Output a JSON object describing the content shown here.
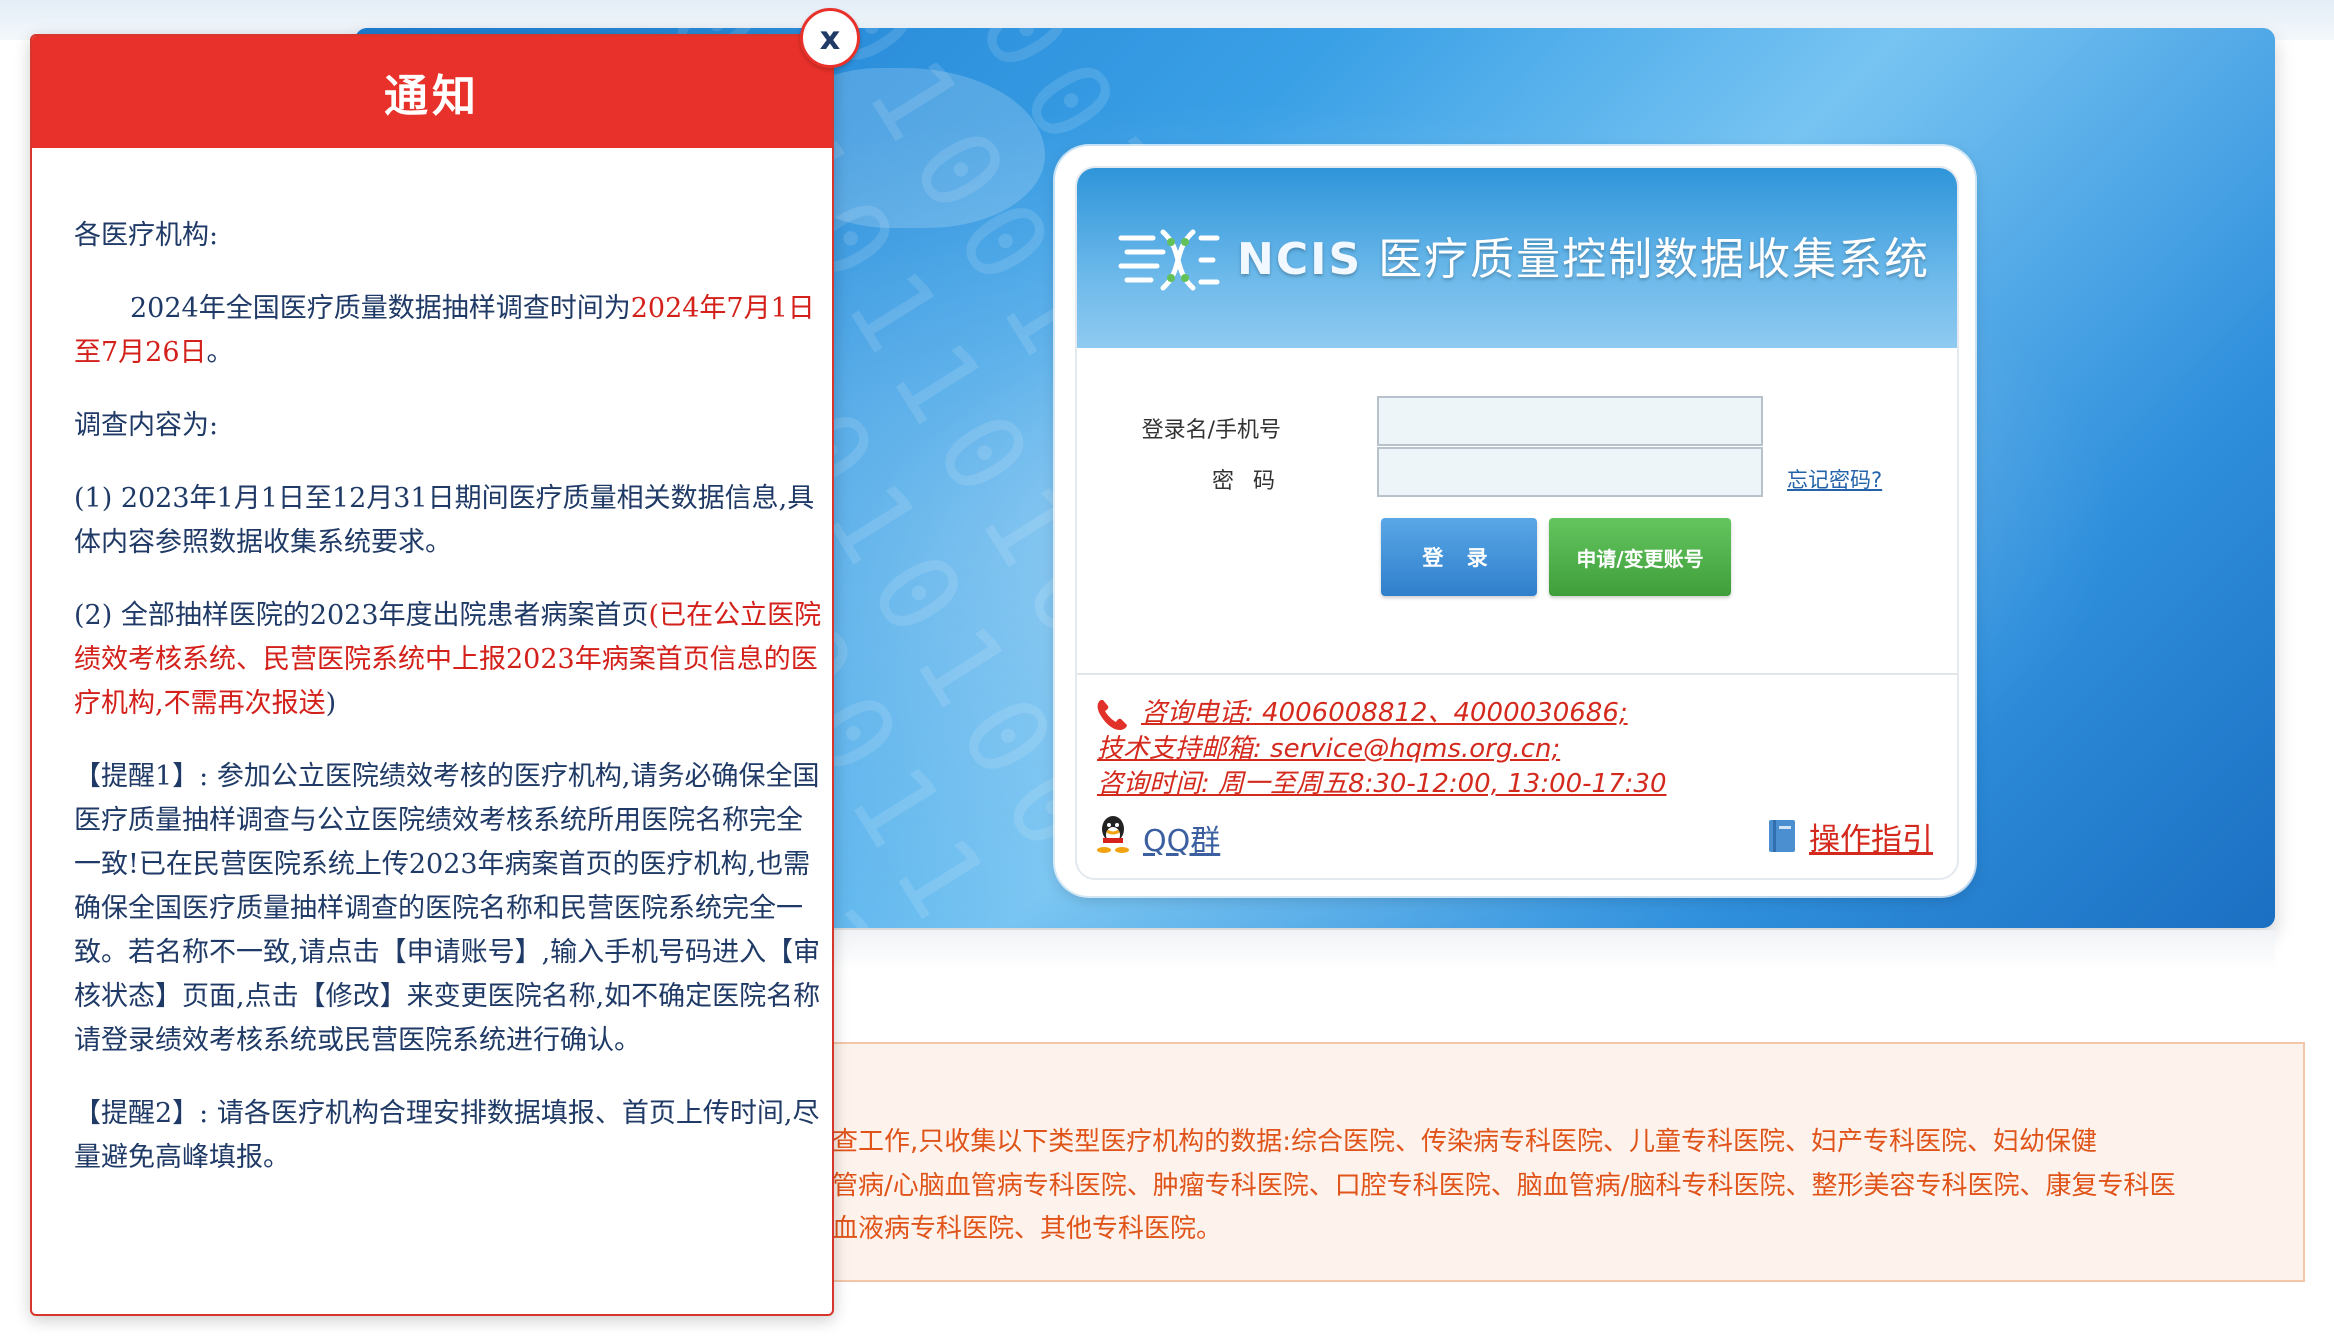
{
  "popup": {
    "title": "通知",
    "close_label": "x",
    "greeting": "各医疗机构:",
    "schedule_prefix": "2024年全国医疗质量数据抽样调查时间为",
    "schedule_dates": "2024年7月1日至7月26日",
    "schedule_suffix": "。",
    "content_heading": "调查内容为:",
    "item1": "(1) 2023年1月1日至12月31日期间医疗质量相关数据信息,具体内容参照数据收集系统要求。",
    "item2_prefix": "(2) 全部抽样医院的2023年度出院患者病案首页",
    "item2_red": "(已在公立医院绩效考核系统、民营医院系统中上报2023年病案首页信息的医疗机构,不需再次报送",
    "item2_suffix": ")",
    "reminder1": "【提醒1】: 参加公立医院绩效考核的医疗机构,请务必确保全国医疗质量抽样调查与公立医院绩效考核系统所用医院名称完全一致!已在民营医院系统上传2023年病案首页的医疗机构,也需确保全国医疗质量抽样调查的医院名称和民营医院系统完全一致。若名称不一致,请点击【申请账号】,输入手机号码进入【审核状态】页面,点击【修改】来变更医院名称,如不确定医院名称请登录绩效考核系统或民营医院系统进行确认。",
    "reminder2": "【提醒2】: 请各医疗机构合理安排数据填报、首页上传时间,尽量避免高峰填报。"
  },
  "login": {
    "brand_prefix": "NCIS",
    "brand_title": "医疗质量控制数据收集系统",
    "username_label": "登录名/手机号",
    "username_value": "",
    "password_label": "密  码",
    "password_value": "",
    "forgot_label": "忘记密码?",
    "login_button": "登 录",
    "apply_button": "申请/变更账号",
    "contact_phone": "咨询电话: 4006008812、4000030686;",
    "contact_email": "技术支持邮箱: service@hqms.org.cn;",
    "contact_hours": "咨询时间: 周一至周五8:30-12:00, 13:00-17:30",
    "qq_label": "QQ群",
    "guide_label": "操作指引"
  },
  "notice": {
    "line1": "查工作,只收集以下类型医疗机构的数据:综合医院、传染病专科医院、儿童专科医院、妇产专科医院、妇幼保健",
    "line2": "管病/心脑血管病专科医院、肿瘤专科医院、口腔专科医院、脑血管病/脑科专科医院、整形美容专科医院、康复专科医",
    "line3": "血液病专科医院、其他专科医院。"
  },
  "colors": {
    "popup_red": "#e8312a",
    "text_navy": "#1f3a66",
    "link_red": "#d42a1e",
    "login_blue": "#2f7fcc",
    "apply_green": "#3f9e3a",
    "notice_orange": "#e0541a"
  }
}
